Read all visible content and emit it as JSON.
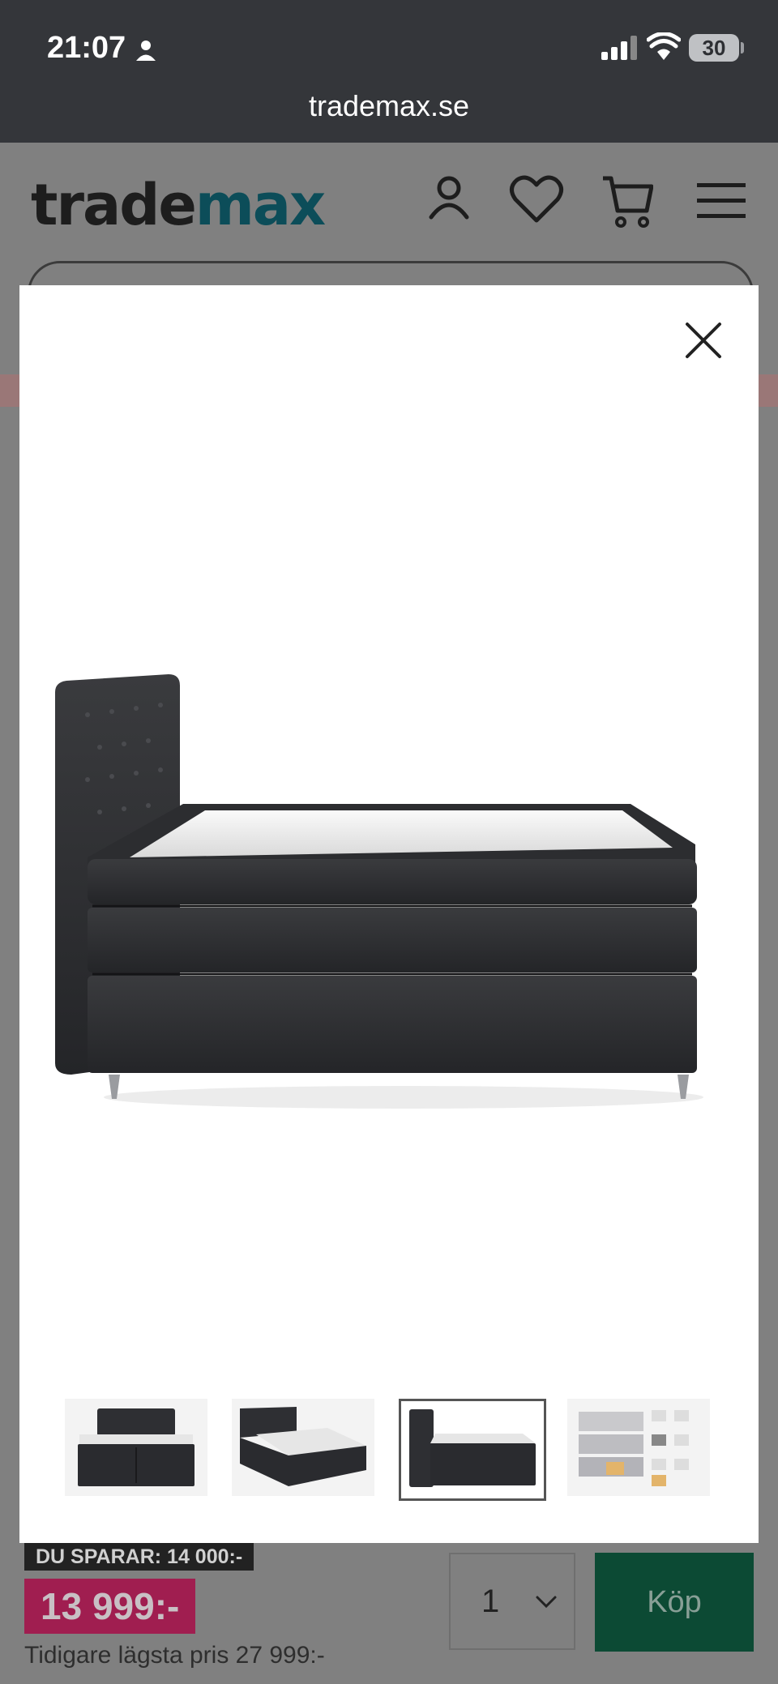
{
  "status_bar": {
    "time": "21:07",
    "battery": "30"
  },
  "browser": {
    "url": "trademax.se"
  },
  "header": {
    "logo_part1": "trade",
    "logo_part2": "max"
  },
  "gallery": {
    "thumbnails": [
      {
        "name": "thumb-front-view",
        "active": false
      },
      {
        "name": "thumb-angled-view",
        "active": false
      },
      {
        "name": "thumb-side-view",
        "active": true
      },
      {
        "name": "thumb-spec-diagram",
        "active": false
      }
    ]
  },
  "product": {
    "savings": "DU SPARAR: 14 000:-",
    "price": "13 999:-",
    "previous_price": "Tidigare lägsta pris 27 999:-",
    "quantity": "1",
    "buy_label": "Köp"
  },
  "colors": {
    "brand_dark": "#1d1d1d",
    "brand_accent": "#0c4d59",
    "price_bg": "#a01e50",
    "buy_bg": "#0c4a34"
  }
}
